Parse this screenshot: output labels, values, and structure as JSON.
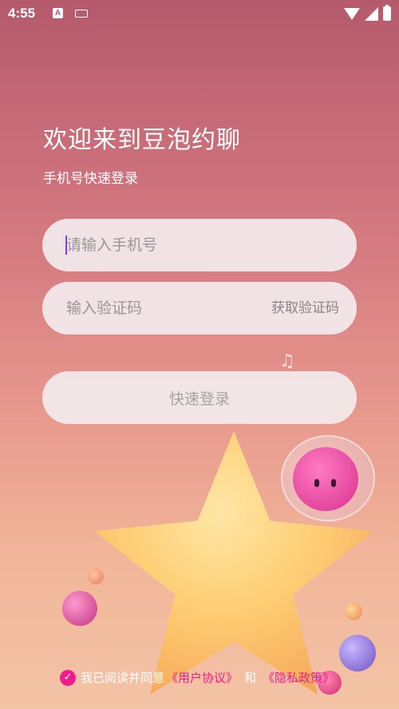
{
  "status_bar": {
    "time": "4:55",
    "a_badge": "A"
  },
  "header": {
    "title": "欢迎来到豆泡约聊",
    "subtitle": "手机号快速登录"
  },
  "form": {
    "phone_placeholder": "请输入手机号",
    "code_placeholder": "输入验证码",
    "get_code_label": "获取验证码",
    "login_label": "快速登录"
  },
  "agreement": {
    "prefix": "我已阅读并同意",
    "user_agreement": "《用户协议》",
    "and": "和",
    "privacy_policy": "《隐私政策》",
    "checked": true
  },
  "colors": {
    "accent": "#ee1d8c",
    "caret": "#7b3fe4"
  }
}
